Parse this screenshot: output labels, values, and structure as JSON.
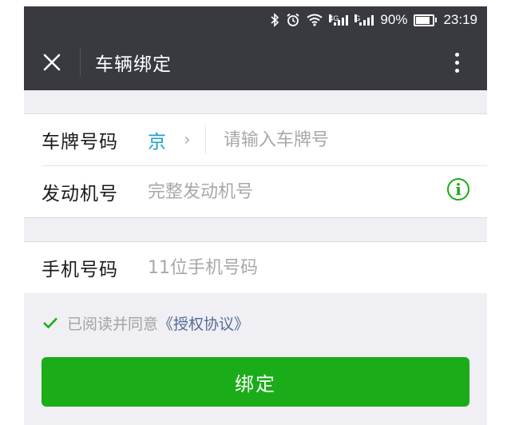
{
  "status_bar": {
    "net1": "4G",
    "net2": "G",
    "battery": "90%",
    "battery_level": 0.9,
    "time": "23:19",
    "icons": [
      "bluetooth-icon",
      "alarm-icon",
      "wifi-icon",
      "signal-icon",
      "signal-icon",
      "battery-icon"
    ]
  },
  "nav": {
    "title": "车辆绑定",
    "close_icon": "close-icon",
    "more_icon": "more-vertical-icon"
  },
  "form": {
    "plate": {
      "label": "车牌号码",
      "province": "京",
      "placeholder": "请输入车牌号",
      "chevron": "›"
    },
    "engine": {
      "label": "发动机号",
      "placeholder": "完整发动机号",
      "info_icon": "i"
    },
    "phone": {
      "label": "手机号码",
      "placeholder": "11位手机号码"
    }
  },
  "agreement": {
    "checked": true,
    "text": "已阅读并同意",
    "link": "《授权协议》"
  },
  "bind_button": {
    "label": "绑定"
  },
  "colors": {
    "bar": "#393a3f",
    "accent_green": "#1aad19",
    "province_blue": "#1aa3c9",
    "link_blue": "#576b95",
    "background": "#efeff4"
  }
}
